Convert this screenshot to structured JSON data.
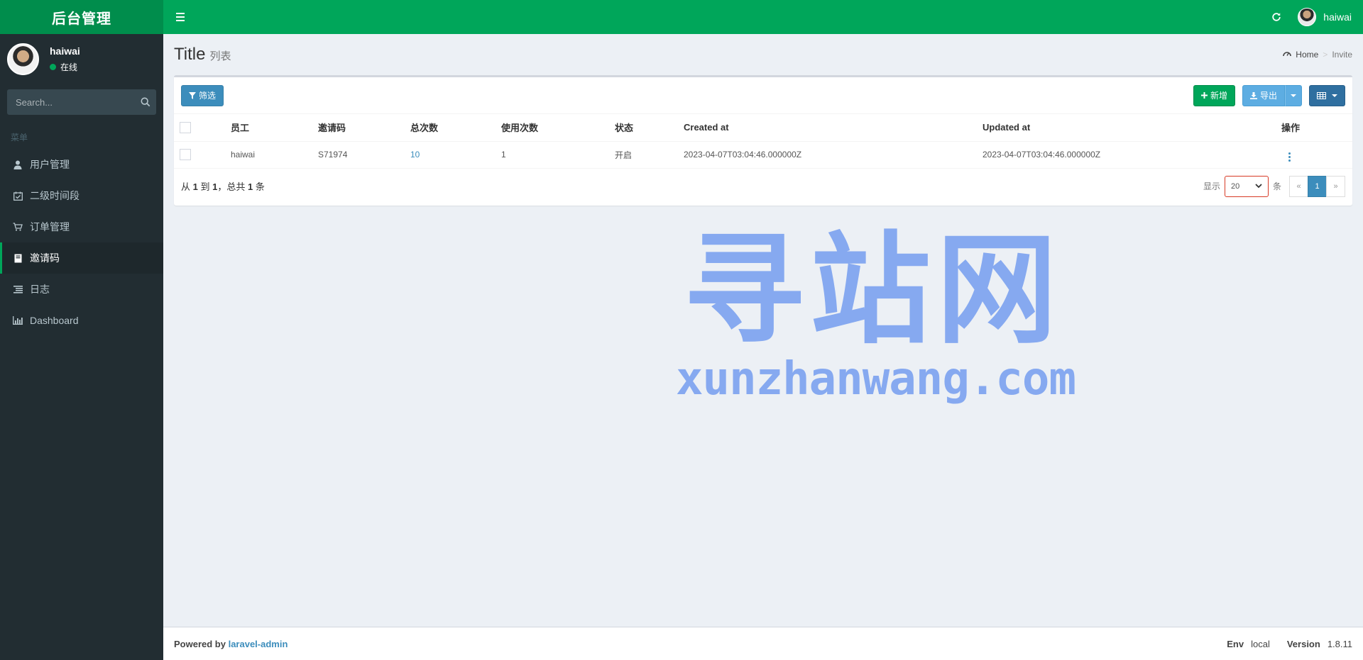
{
  "app": {
    "logo_text": "后台管理"
  },
  "header": {
    "user_name": "haiwai"
  },
  "sidebar": {
    "user": {
      "name": "haiwai",
      "status": "在线"
    },
    "search_placeholder": "Search...",
    "menu_header": "菜单",
    "items": [
      {
        "label": "用户管理",
        "icon": "user-icon"
      },
      {
        "label": "二级时间段",
        "icon": "calendar-check-icon"
      },
      {
        "label": "订单管理",
        "icon": "cart-icon"
      },
      {
        "label": "邀请码",
        "icon": "book-icon"
      },
      {
        "label": "日志",
        "icon": "list-icon"
      },
      {
        "label": "Dashboard",
        "icon": "bar-chart-icon"
      }
    ]
  },
  "page": {
    "title": "Title",
    "subtitle": "列表",
    "breadcrumb": {
      "home": "Home",
      "current": "Invite"
    }
  },
  "toolbar": {
    "filter_label": "筛选",
    "new_label": "新增",
    "export_label": "导出"
  },
  "table": {
    "headers": [
      "员工",
      "邀请码",
      "总次数",
      "使用次数",
      "状态",
      "Created at",
      "Updated at",
      "操作"
    ],
    "rows": [
      {
        "employee": "haiwai",
        "code": "S71974",
        "total": "10",
        "used": "1",
        "status": "开启",
        "created_at": "2023-04-07T03:04:46.000000Z",
        "updated_at": "2023-04-07T03:04:46.000000Z"
      }
    ]
  },
  "pagination": {
    "summary_prefix": "从",
    "from": "1",
    "to_word": "到",
    "to": "1",
    "total_word": "，总共",
    "total": "1",
    "suffix": "条",
    "show_label": "显示",
    "per_page": "20",
    "per_page_suffix": "条",
    "prev": "«",
    "current_page": "1",
    "next": "»"
  },
  "watermark": {
    "title": "寻站网",
    "domain": "xunzhanwang.com"
  },
  "footer": {
    "powered_by": "Powered by",
    "powered_link": "laravel-admin",
    "env_label": "Env",
    "env_value": "local",
    "version_label": "Version",
    "version_value": "1.8.11"
  },
  "colors": {
    "header_green": "#00a65a",
    "logo_green": "#008d4c",
    "sidebar_bg": "#222d32",
    "primary_blue": "#3c8dbc",
    "content_bg": "#ecf0f5",
    "watermark_blue": "#86a9f0"
  }
}
